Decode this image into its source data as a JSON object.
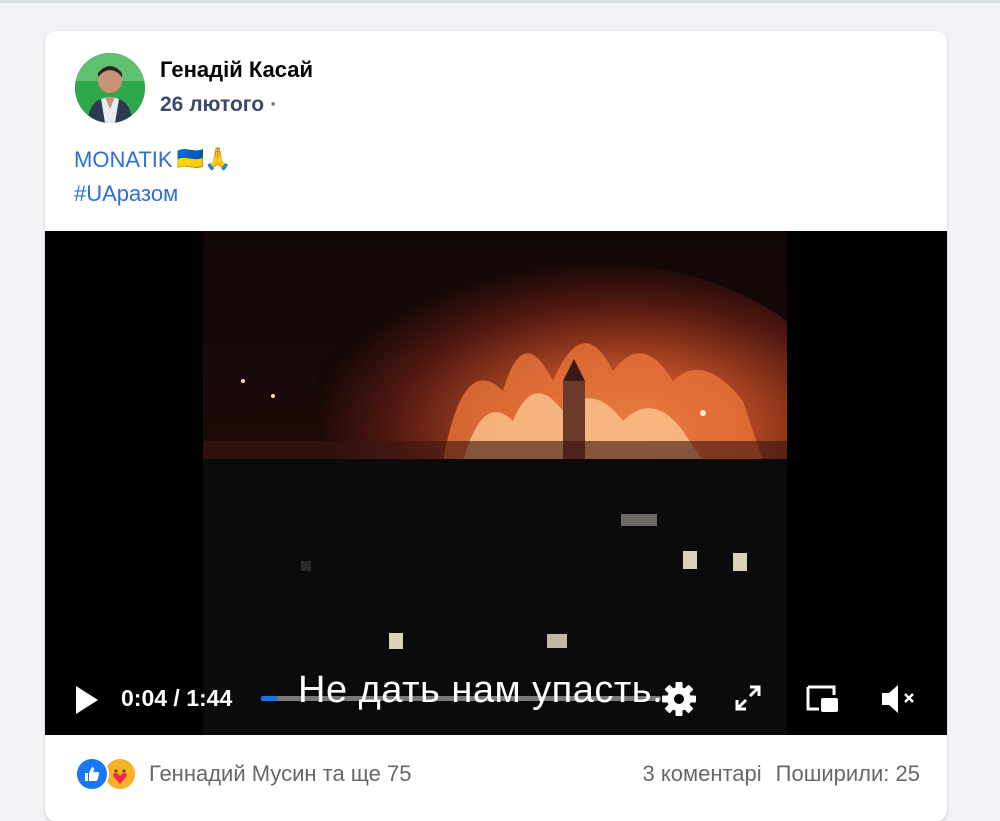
{
  "post": {
    "author": "Генадій Касай",
    "date": "26 лютого",
    "meta_separator": "·",
    "text_line1": "MONATIK",
    "text_emoji": "🇺🇦🙏",
    "hashtag": "#UAразом"
  },
  "video": {
    "subtitle": "Не дать нам упасть...",
    "time": "0:04 / 1:44",
    "progress": 0.04,
    "icons": [
      "play-icon",
      "gear-icon",
      "expand-icon",
      "picture-in-picture-icon",
      "mute-icon"
    ]
  },
  "footer": {
    "reactors": "Геннадий Мусин та ще 75",
    "comments": "3 коментарі",
    "shares": "Поширили: 25"
  },
  "colors": {
    "link": "#2d6fd8",
    "progress": "#1b74e4",
    "like": "#1877f2",
    "care": "#f7b125"
  }
}
